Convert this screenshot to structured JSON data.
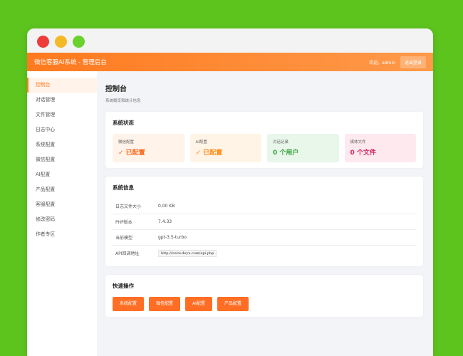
{
  "app": {
    "title": "微信客服AI系统 - 管理后台"
  },
  "header": {
    "welcome": "欢迎，admin",
    "logout_label": "退出登录"
  },
  "sidebar": {
    "items": [
      {
        "label": "控制台",
        "active": true
      },
      {
        "label": "对话管理"
      },
      {
        "label": "文件管理"
      },
      {
        "label": "日志中心"
      },
      {
        "label": "系统配置"
      },
      {
        "label": "微信配置"
      },
      {
        "label": "AI配置"
      },
      {
        "label": "产品配置"
      },
      {
        "label": "客服配置"
      },
      {
        "label": "修改密码"
      },
      {
        "label": "作者专区"
      }
    ]
  },
  "page": {
    "title": "控制台",
    "subtitle": "系统概览和统计信息"
  },
  "status": {
    "title": "系统状态",
    "cards": [
      {
        "label": "微信配置",
        "value": "✓ 已配置"
      },
      {
        "label": "AI配置",
        "value": "✓ 已配置"
      },
      {
        "label": "对话记录",
        "value": "0 个用户"
      },
      {
        "label": "媒体文件",
        "value": "0 个文件"
      }
    ]
  },
  "info": {
    "title": "系统信息",
    "rows": [
      {
        "label": "日志文件大小",
        "value": "0.00 KB"
      },
      {
        "label": "PHP版本",
        "value": "7.4.33"
      },
      {
        "label": "当前模型",
        "value": "gpt-3.5-turbo"
      },
      {
        "label": "API回调地址",
        "value": "http://www.deyu.com/api.php"
      }
    ]
  },
  "quick": {
    "title": "快速操作",
    "buttons": [
      "系统配置",
      "微信配置",
      "AI配置",
      "产品配置"
    ]
  },
  "colors": {
    "accent": "#ff7a1f",
    "background": "#5dc41e"
  }
}
